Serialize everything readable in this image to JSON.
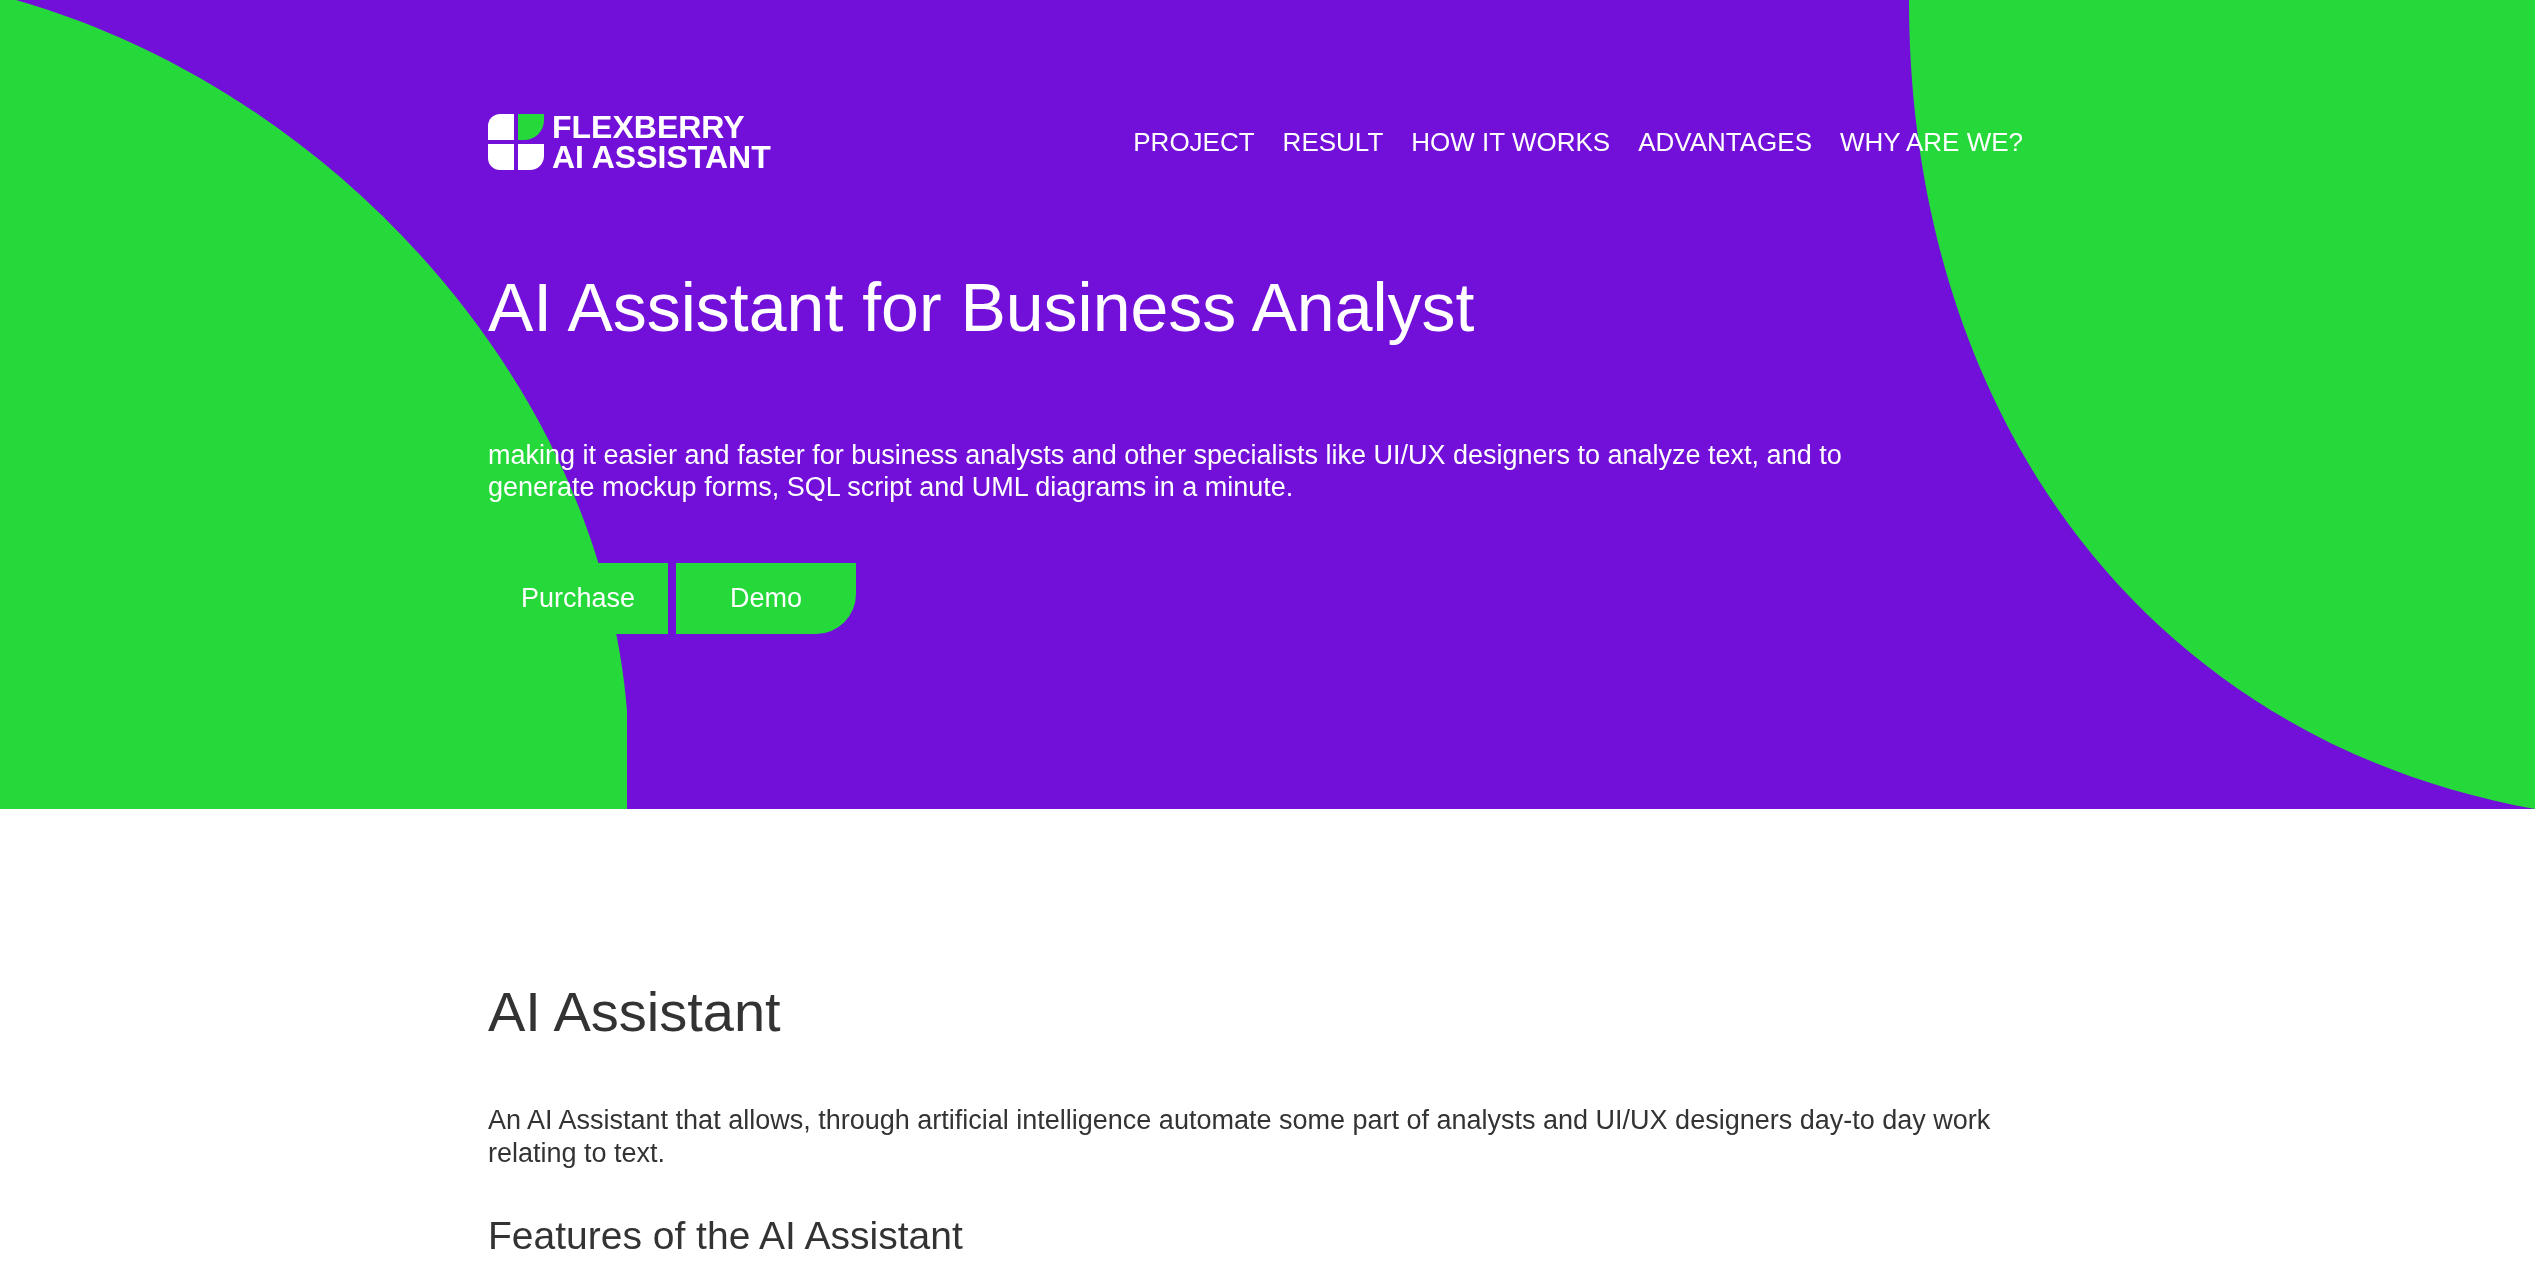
{
  "logo": {
    "line_1": "FLEXBERRY",
    "line_2": "AI ASSISTANT"
  },
  "nav": [
    {
      "label": "PROJECT"
    },
    {
      "label": "RESULT"
    },
    {
      "label": "HOW IT WORKS"
    },
    {
      "label": "ADVANTAGES"
    },
    {
      "label": "WHY ARE WE?"
    }
  ],
  "hero": {
    "title": "AI Assistant for Business Analyst",
    "subtitle": "making it easier and faster for business analysts and other specialists like UI/UX designers to analyze text, and to generate mockup forms, SQL script and UML diagrams in a minute.",
    "buttons": [
      {
        "label": "Purchase",
        "kind": "square"
      },
      {
        "label": "Demo",
        "kind": "rounded"
      }
    ]
  },
  "section": {
    "title": "AI Assistant",
    "text": "An AI Assistant that allows, through artificial intelligence automate some part of analysts and UI/UX designers day-to day work relating to text.",
    "subtitle": "Features of the AI Assistant"
  }
}
